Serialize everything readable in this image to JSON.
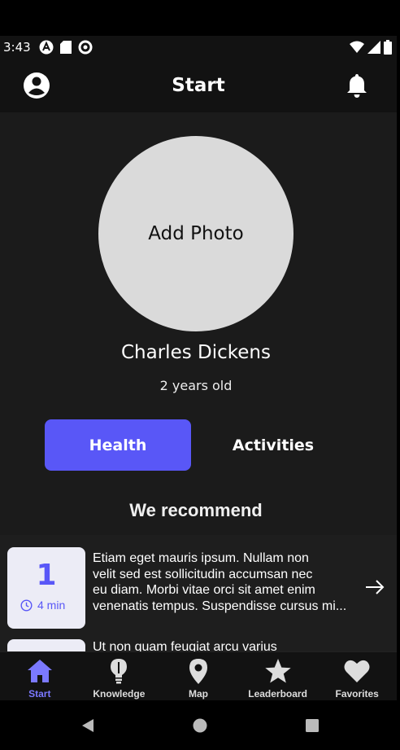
{
  "status_bar": {
    "time": "3:43",
    "icons": [
      "app-a-icon",
      "sd-card-icon",
      "data-saver-icon"
    ],
    "right_icons": [
      "wifi-icon",
      "signal-icon",
      "battery-icon"
    ]
  },
  "app_bar": {
    "title": "Start",
    "left_icon": "account-circle-icon",
    "right_icon": "bell-icon"
  },
  "profile": {
    "photo_label": "Add Photo",
    "name": "Charles Dickens",
    "age": "2 years old"
  },
  "tabs": [
    {
      "label": "Health",
      "active": true
    },
    {
      "label": "Activities",
      "active": false
    }
  ],
  "recommend": {
    "title": "We recommend",
    "items": [
      {
        "number": "1",
        "duration": "4 min",
        "lines": [
          "Etiam eget mauris ipsum. Nullam non",
          "velit sed est sollicitudin accumsan nec",
          "eu diam. Morbi vitae orci sit amet enim",
          "venenatis tempus. Suspendisse cursus mi..."
        ]
      },
      {
        "lines": [
          "Ut non quam feugiat arcu varius"
        ]
      }
    ]
  },
  "bottom_nav": [
    {
      "label": "Start",
      "icon": "home-icon",
      "active": true
    },
    {
      "label": "Knowledge",
      "icon": "lightbulb-icon",
      "active": false
    },
    {
      "label": "Map",
      "icon": "map-pin-icon",
      "active": false
    },
    {
      "label": "Leaderboard",
      "icon": "star-icon",
      "active": false
    },
    {
      "label": "Favorites",
      "icon": "heart-icon",
      "active": false
    }
  ],
  "colors": {
    "accent": "#5957f7",
    "nav_active": "#7b79ff",
    "background": "#1b1b1b",
    "bar": "#121212"
  }
}
